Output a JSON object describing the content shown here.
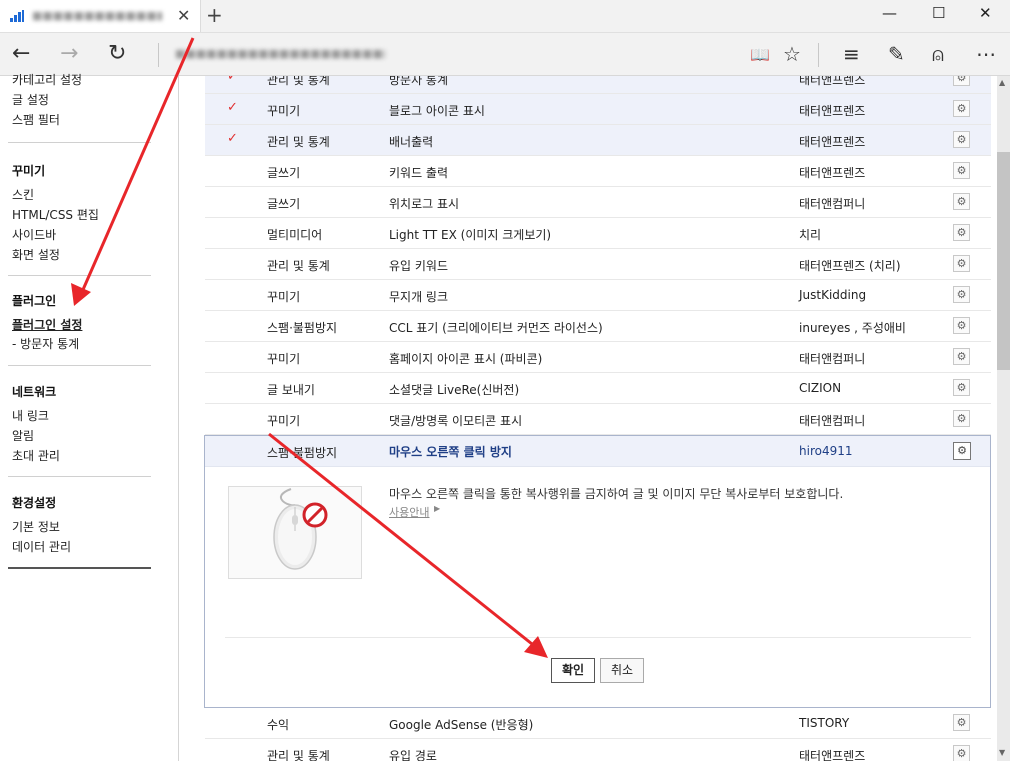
{
  "browser": {
    "tab_close": "✕",
    "new_tab": "+",
    "window": {
      "minimize": "—",
      "maximize": "☐",
      "close": "✕"
    },
    "nav": {
      "back": "←",
      "forward": "→",
      "refresh": "↻"
    },
    "toolbar": {
      "reading": "📖",
      "favorite": "☆",
      "hub": "≡",
      "note": "✎",
      "share": "⍝",
      "more": "⋯"
    }
  },
  "sidebar": {
    "top_items": [
      "카테고리 설정",
      "글 설정",
      "스팸 필터"
    ],
    "groups": [
      {
        "title": "꾸미기",
        "items": [
          "스킨",
          "HTML/CSS 편집",
          "사이드바",
          "화면 설정"
        ]
      },
      {
        "title": "플러그인",
        "items": [
          "플러그인 설정",
          "- 방문자 통계"
        ],
        "active": "플러그인 설정"
      },
      {
        "title": "네트워크",
        "items": [
          "내 링크",
          "알림",
          "초대 관리"
        ]
      },
      {
        "title": "환경설정",
        "items": [
          "기본 정보",
          "데이터 관리"
        ]
      }
    ]
  },
  "plugins": {
    "rows": [
      {
        "checked": true,
        "category": "관리 및 통계",
        "name": "방문자 통계",
        "author": "태터앤프렌즈"
      },
      {
        "checked": true,
        "category": "꾸미기",
        "name": "블로그 아이콘 표시",
        "author": "태터앤프렌즈"
      },
      {
        "checked": true,
        "category": "관리 및 통계",
        "name": "배너출력",
        "author": "태터앤프렌즈"
      },
      {
        "checked": false,
        "category": "글쓰기",
        "name": "키워드 출력",
        "author": "태터앤프렌즈"
      },
      {
        "checked": false,
        "category": "글쓰기",
        "name": "위치로그 표시",
        "author": "태터앤컴퍼니"
      },
      {
        "checked": false,
        "category": "멀티미디어",
        "name": "Light TT EX (이미지 크게보기)",
        "author": "치리"
      },
      {
        "checked": false,
        "category": "관리 및 통계",
        "name": "유입 키워드",
        "author": "태터앤프렌즈 (치리)"
      },
      {
        "checked": false,
        "category": "꾸미기",
        "name": "무지개 링크",
        "author": "JustKidding"
      },
      {
        "checked": false,
        "category": "스팸·불펌방지",
        "name": "CCL 표기 (크리에이티브 커먼즈 라이선스)",
        "author": "inureyes , 주성애비"
      },
      {
        "checked": false,
        "category": "꾸미기",
        "name": "홈페이지 아이콘 표시 (파비콘)",
        "author": "태터앤컴퍼니"
      },
      {
        "checked": false,
        "category": "글 보내기",
        "name": "소셜댓글 LiveRe(신버전)",
        "author": "CIZION"
      },
      {
        "checked": false,
        "category": "꾸미기",
        "name": "댓글/방명록 이모티콘 표시",
        "author": "태터앤컴퍼니"
      }
    ],
    "expanded": {
      "category": "스팸·불펌방지",
      "name": "마우스 오른쪽 클릭 방지",
      "author": "hiro4911",
      "description": "마우스 오른쪽 클릭을 통한 복사행위를 금지하여 글 및 이미지 무단 복사로부터 보호합니다.",
      "guide_link": "사용안내",
      "confirm_label": "확인",
      "cancel_label": "취소"
    },
    "rows_after": [
      {
        "checked": false,
        "category": "수익",
        "name": "Google AdSense (반응형)",
        "author": "TISTORY"
      },
      {
        "checked": false,
        "category": "관리 및 통계",
        "name": "유입 경로",
        "author": "태터앤프렌즈"
      }
    ],
    "check_glyph": "✓",
    "gear_glyph": "⚙"
  },
  "colors": {
    "arrow": "#e8262a",
    "selected_row": "#eef1fa",
    "highlight_text": "#1f3f86"
  }
}
